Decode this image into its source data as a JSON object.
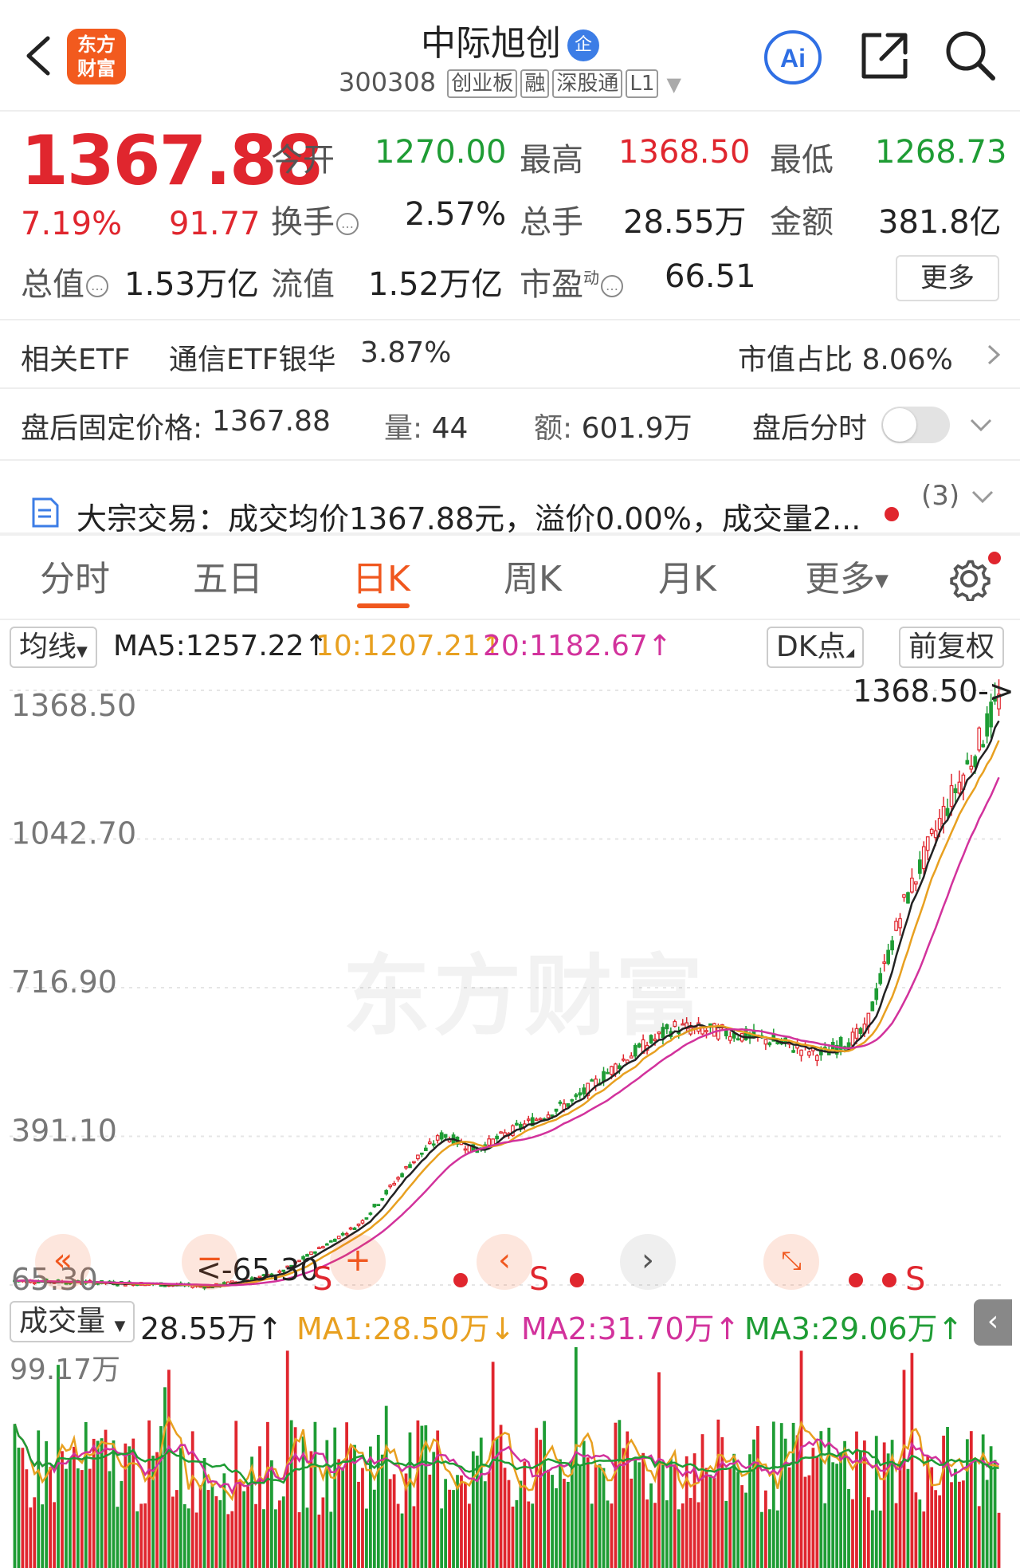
{
  "header": {
    "title": "中际旭创",
    "ent_badge": "企",
    "code": "300308",
    "tags": [
      "创业板",
      "融",
      "深股通",
      "L1"
    ],
    "logo_line1": "东方",
    "logo_line2": "财富",
    "ai_label": "Ai"
  },
  "quote": {
    "price": "1367.88",
    "change_pct": "7.19%",
    "change_val": "91.77",
    "open_label": "今开",
    "open_val": "1270.00",
    "high_label": "最高",
    "high_val": "1368.50",
    "low_label": "最低",
    "low_val": "1268.73",
    "turnover_label": "换手",
    "turnover_val": "2.57%",
    "volume_label": "总手",
    "volume_val": "28.55万",
    "amount_label": "金额",
    "amount_val": "381.8亿",
    "mktcap_label": "总值",
    "mktcap_val": "1.53万亿",
    "float_label": "流值",
    "float_val": "1.52万亿",
    "pe_label": "市盈",
    "pe_sup": "动",
    "pe_val": "66.51",
    "more_label": "更多"
  },
  "etf": {
    "label": "相关ETF",
    "name": "通信ETF银华",
    "pct": "3.87%",
    "weight_label": "市值占比",
    "weight_val": "8.06%"
  },
  "after_hours": {
    "price_label": "盘后固定价格:",
    "price_val": "1367.88",
    "vol_label": "量:",
    "vol_val": "44",
    "amt_label": "额:",
    "amt_val": "601.9万",
    "toggle_label": "盘后分时"
  },
  "block_trade": {
    "text": "大宗交易：成交均价1367.88元，溢价0.00%，成交量2...",
    "count": "(3)"
  },
  "tabs": [
    "分时",
    "五日",
    "日K",
    "周K",
    "月K",
    "更多"
  ],
  "active_tab": "日K",
  "ma_row": {
    "selector": "均线",
    "ma5": "MA5:1257.22",
    "ma10": "10:1207.21",
    "ma20": "20:1182.67",
    "dk": "DK点",
    "adjust": "前复权"
  },
  "price_axis": [
    "1368.50",
    "1042.70",
    "716.90",
    "391.10",
    "65.30"
  ],
  "price_annotations": {
    "high_marker": "1368.50->",
    "low_marker": "<-65.30"
  },
  "signal_labels": [
    "S",
    "S",
    "S",
    "S"
  ],
  "volume_row": {
    "selector": "成交量",
    "value": "28.55万",
    "ma1": "MA1:28.50万",
    "ma2": "MA2:31.70万",
    "ma3": "MA3:29.06万"
  },
  "volume_axis_max": "99.17万",
  "watermark": "东方财富",
  "colors": {
    "up": "#e0262e",
    "down": "#1e9c34",
    "accent": "#f0571e",
    "ma5": "#222222",
    "ma10": "#e8a020",
    "ma20": "#d2329c",
    "vma3": "#1e9c34"
  }
}
